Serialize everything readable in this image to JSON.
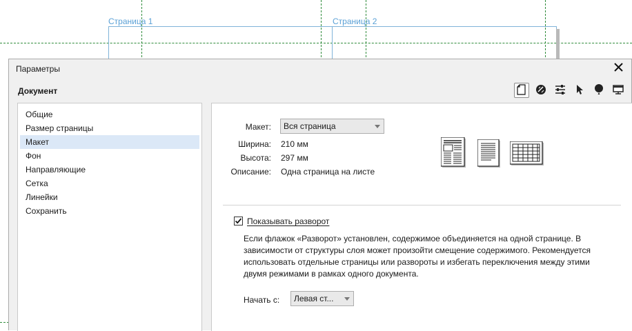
{
  "canvas": {
    "page1_label": "Страница 1",
    "page2_label": "Страница 2"
  },
  "dialog": {
    "title": "Параметры",
    "section_title": "Документ",
    "toolbar": [
      {
        "icon": "document-icon",
        "active": true
      },
      {
        "icon": "color-icon",
        "active": false
      },
      {
        "icon": "sliders-icon",
        "active": false
      },
      {
        "icon": "pointer-icon",
        "active": false
      },
      {
        "icon": "balloon-icon",
        "active": false
      },
      {
        "icon": "display-icon",
        "active": false
      }
    ]
  },
  "tree": {
    "items": [
      {
        "label": "Общие"
      },
      {
        "label": "Размер страницы"
      },
      {
        "label": "Макет",
        "selected": true
      },
      {
        "label": "Фон"
      },
      {
        "label": "Направляющие"
      },
      {
        "label": "Сетка"
      },
      {
        "label": "Линейки"
      },
      {
        "label": "Сохранить"
      }
    ]
  },
  "layout": {
    "layout_label": "Макет:",
    "layout_value": "Вся страница",
    "width_label": "Ширина:",
    "width_value": "210 мм",
    "height_label": "Высота:",
    "height_value": "297 мм",
    "description_label": "Описание:",
    "description_value": "Одна страница на листе",
    "facing_checkbox_label": "Показывать разворот",
    "facing_checked": true,
    "facing_description": "Если флажок «Разворот» установлен, содержимое объединяется на одной странице. В зависимости от структуры слоя может произойти смещение содержимого. Рекомендуется использовать отдельные страницы или развороты и избегать переключения между этими двумя режимами в рамках одного документа.",
    "start_on_label": "Начать с:",
    "start_on_value": "Левая ст..."
  }
}
